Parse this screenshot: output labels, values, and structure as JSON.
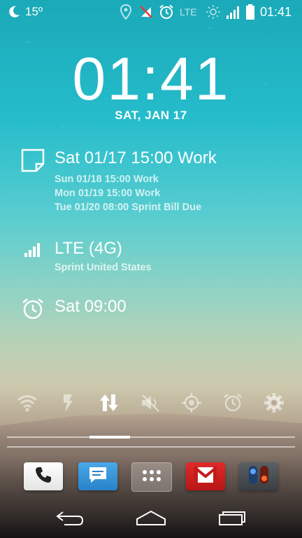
{
  "status_bar": {
    "temperature": "15º",
    "network": "LTE",
    "time": "01:41",
    "icons": [
      "moon-icon",
      "location-icon",
      "sim-muted-icon",
      "alarm-icon",
      "lte-label",
      "brightness-icon",
      "signal-icon",
      "battery-icon"
    ]
  },
  "lockscreen": {
    "time": "01:41",
    "date": "SAT, JAN 17"
  },
  "calendar": {
    "primary": "Sat 01/17 15:00 Work",
    "upcoming": [
      "Sun 01/18 15:00 Work",
      "Mon 01/19 15:00 Work",
      "Tue 01/20 08:00 Sprint Bill Due"
    ]
  },
  "network": {
    "title": "LTE (4G)",
    "carrier": "Sprint United States"
  },
  "alarm": {
    "next": "Sat 09:00"
  },
  "quick_toggles": [
    "wifi-icon",
    "flash-icon",
    "data-transfer-icon",
    "sound-off-icon",
    "gps-icon",
    "alarm-icon",
    "settings-icon"
  ],
  "dock": [
    "phone-icon",
    "messaging-icon",
    "app-drawer-icon",
    "gmail-icon",
    "toggle-app-icon"
  ],
  "navigation": [
    "back-icon",
    "home-icon",
    "recents-icon"
  ],
  "colors": {
    "sky_top": "#1aa9b8",
    "sky_mid": "#58cdd0",
    "gmail_red": "#d11f1f",
    "messaging_blue": "#2f8fd6",
    "white": "#ffffff"
  },
  "slider": {
    "level_percent": 29
  }
}
